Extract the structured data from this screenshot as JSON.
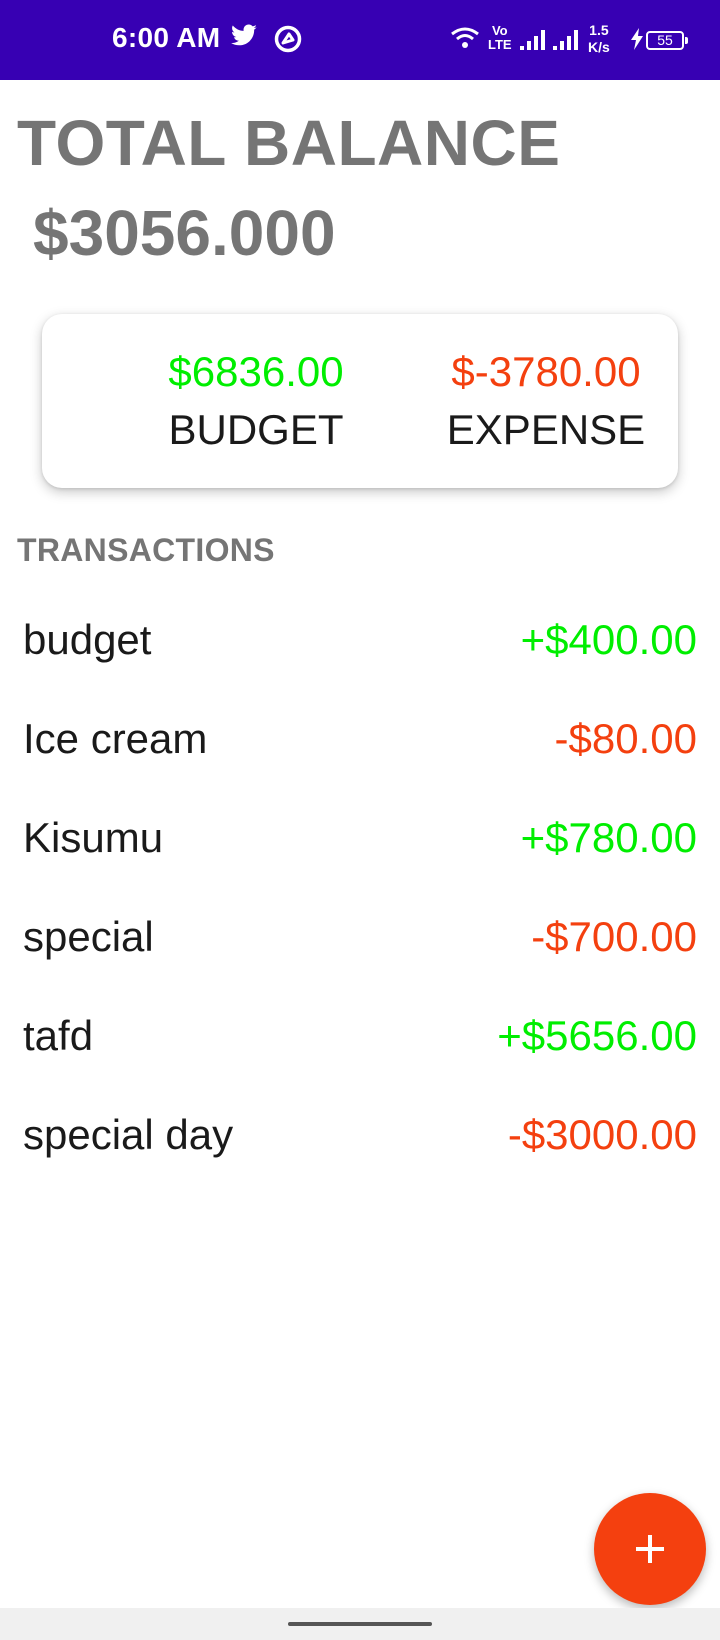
{
  "status_bar": {
    "time": "6:00 AM",
    "volte_line1": "Vo",
    "volte_line2": "LTE",
    "speed_value": "1.5",
    "speed_unit": "K/s",
    "battery_level": "55",
    "background_color": "#3700b3",
    "icons": [
      "twitter-icon",
      "sync-icon",
      "wifi-icon",
      "signal-icon",
      "signal-icon",
      "charging-bolt-icon",
      "battery-icon"
    ]
  },
  "balance": {
    "title": "TOTAL BALANCE",
    "amount": "$3056.000"
  },
  "summary": {
    "budget_amount": "$6836.00",
    "budget_label": "BUDGET",
    "expense_amount": "$-3780.00",
    "expense_label": "EXPENSE"
  },
  "transactions": {
    "title": "TRANSACTIONS",
    "items": [
      {
        "name": "budget",
        "amount": "+$400.00",
        "type": "income"
      },
      {
        "name": "Ice cream",
        "amount": "-$80.00",
        "type": "expense"
      },
      {
        "name": "Kisumu",
        "amount": "+$780.00",
        "type": "income"
      },
      {
        "name": "special",
        "amount": "-$700.00",
        "type": "expense"
      },
      {
        "name": "tafd",
        "amount": "+$5656.00",
        "type": "income"
      },
      {
        "name": "special day",
        "amount": "-$3000.00",
        "type": "expense"
      }
    ]
  },
  "fab": {
    "icon": "plus-icon"
  },
  "colors": {
    "income": "#00ee00",
    "expense": "#f4400f",
    "fab": "#f4400f",
    "heading": "#757575"
  }
}
